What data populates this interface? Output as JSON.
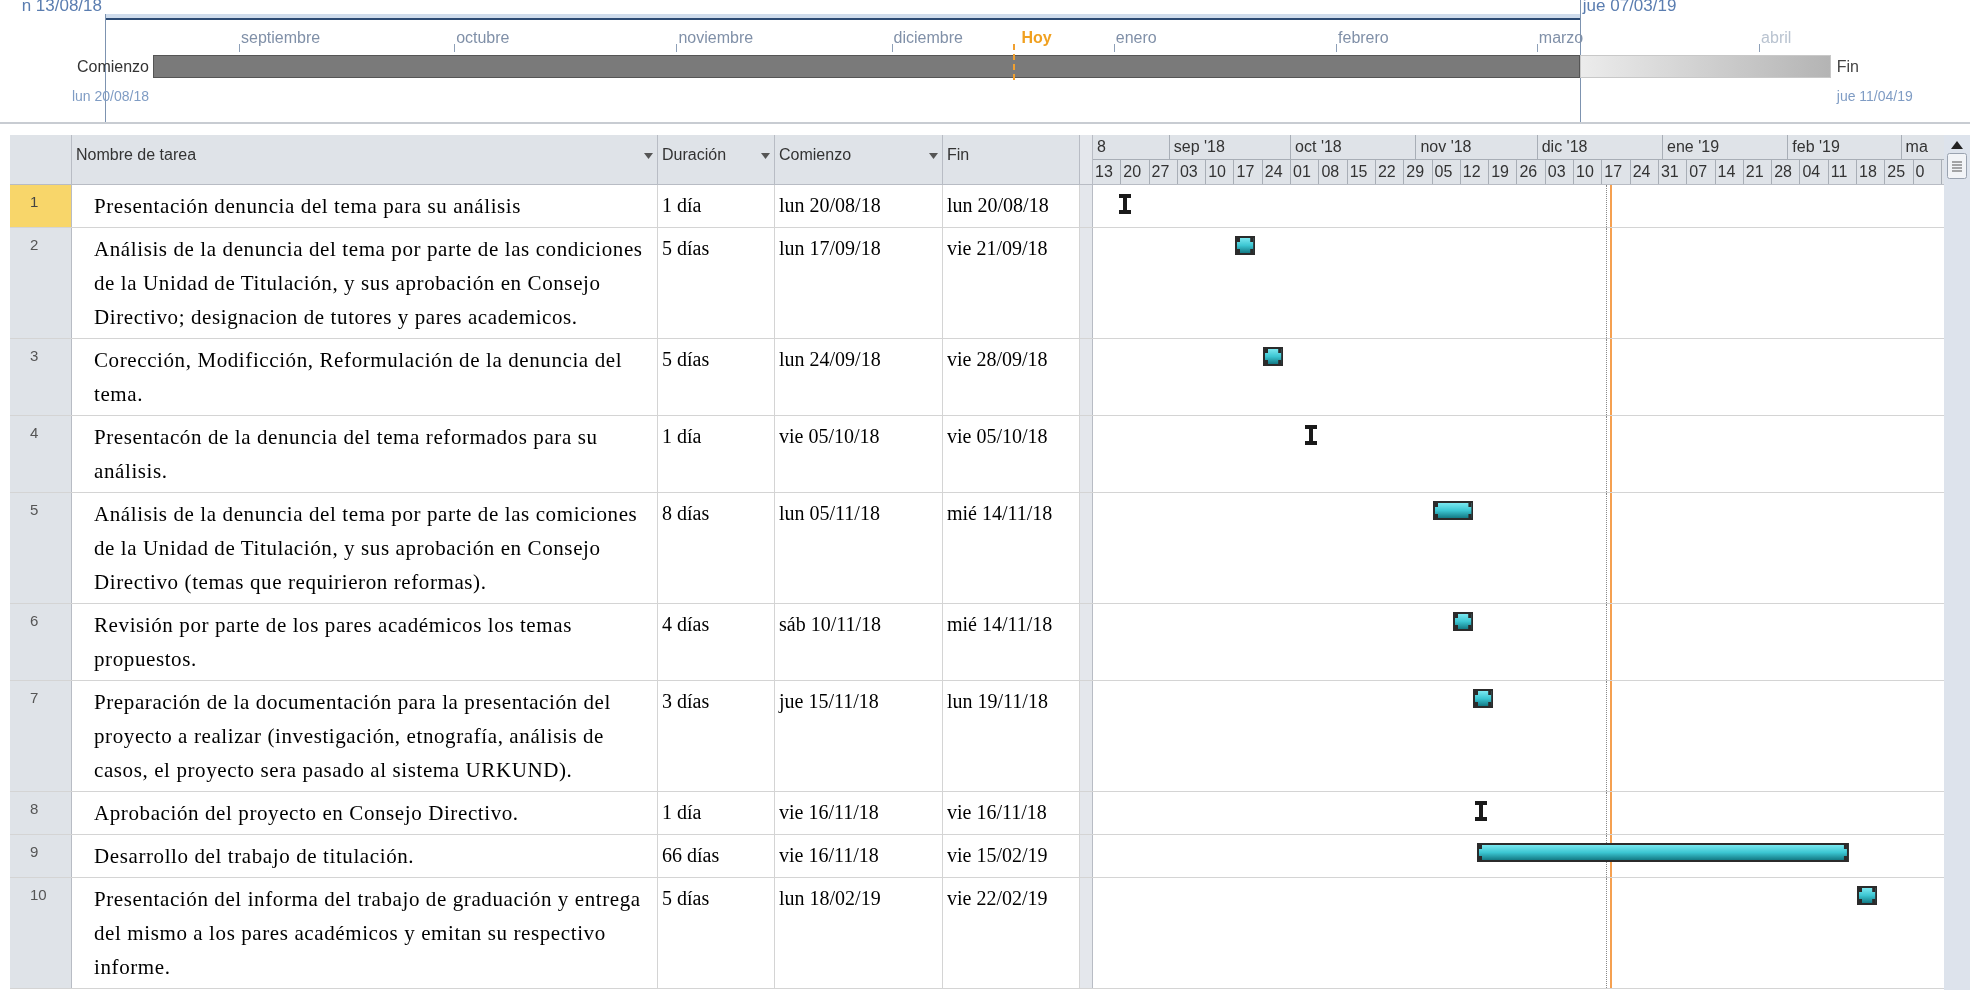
{
  "timeline": {
    "range_start": "n 13/08/18",
    "range_end": "jue 07/03/19",
    "months": [
      "septiembre",
      "octubre",
      "noviembre",
      "diciembre",
      "enero",
      "febrero",
      "marzo",
      "abril"
    ],
    "today": "Hoy",
    "start_label": "Comienzo",
    "start_date": "lun 20/08/18",
    "finish_label": "Fin",
    "finish_date": "jue 11/04/19"
  },
  "table": {
    "columns": [
      "Nombre de tarea",
      "Duración",
      "Comienzo",
      "Fin"
    ],
    "rows": [
      {
        "id": "1",
        "name": "Presentación denuncia del tema para su análisis",
        "duration": "1 día",
        "start": "lun 20/08/18",
        "finish": "lun 20/08/18",
        "selected": true
      },
      {
        "id": "2",
        "name": "Análisis de la denuncia del tema por parte de las condiciones de la Unidad de Titulación, y sus aprobación en Consejo Directivo; designacion de tutores y pares academicos.",
        "duration": "5 días",
        "start": "lun 17/09/18",
        "finish": "vie 21/09/18",
        "selected": false
      },
      {
        "id": "3",
        "name": "Corección, Modificción, Reformulación de la denuncia del tema.",
        "duration": "5 días",
        "start": "lun 24/09/18",
        "finish": "vie 28/09/18",
        "selected": false
      },
      {
        "id": "4",
        "name": "Presentacón de la denuncia del tema reformados para su análisis.",
        "duration": "1 día",
        "start": "vie 05/10/18",
        "finish": "vie 05/10/18",
        "selected": false
      },
      {
        "id": "5",
        "name": "Análisis de la denuncia del tema por parte de las comiciones de la Unidad de Titulación, y sus aprobación en Consejo Directivo (temas que requirieron reformas).",
        "duration": "8 días",
        "start": "lun 05/11/18",
        "finish": "mié 14/11/18",
        "selected": false
      },
      {
        "id": "6",
        "name": "Revisión por parte de los pares académicos los temas propuestos.",
        "duration": "4 días",
        "start": "sáb 10/11/18",
        "finish": "mié 14/11/18",
        "selected": false
      },
      {
        "id": "7",
        "name": "Preparación de la documentación para la presentación del proyecto a realizar (investigación, etnografía, análisis de casos, el proyecto sera pasado al sistema URKUND).",
        "duration": "3 días",
        "start": "jue 15/11/18",
        "finish": "lun 19/11/18",
        "selected": false
      },
      {
        "id": "8",
        "name": "Aprobación del proyecto en Consejo Directivo.",
        "duration": "1 día",
        "start": "vie 16/11/18",
        "finish": "vie 16/11/18",
        "selected": false
      },
      {
        "id": "9",
        "name": "Desarrollo del trabajo de titulación.",
        "duration": "66 días",
        "start": "vie 16/11/18",
        "finish": "vie 15/02/19",
        "selected": false
      },
      {
        "id": "10",
        "name": "Presentación del informa del trabajo de graduación y entrega del mismo a los pares académicos y emitan su respectivo informe.",
        "duration": "5 días",
        "start": "lun 18/02/19",
        "finish": "vie 22/02/19",
        "selected": false
      }
    ]
  },
  "gantt": {
    "months": [
      "8",
      "sep '18",
      "oct '18",
      "nov '18",
      "dic '18",
      "ene '19",
      "feb '19",
      "ma"
    ],
    "weeks": [
      "13",
      "20",
      "27",
      "03",
      "10",
      "17",
      "24",
      "01",
      "08",
      "15",
      "22",
      "29",
      "05",
      "12",
      "19",
      "26",
      "03",
      "10",
      "17",
      "24",
      "31",
      "07",
      "14",
      "21",
      "28",
      "04",
      "11",
      "18",
      "25",
      "0"
    ]
  }
}
